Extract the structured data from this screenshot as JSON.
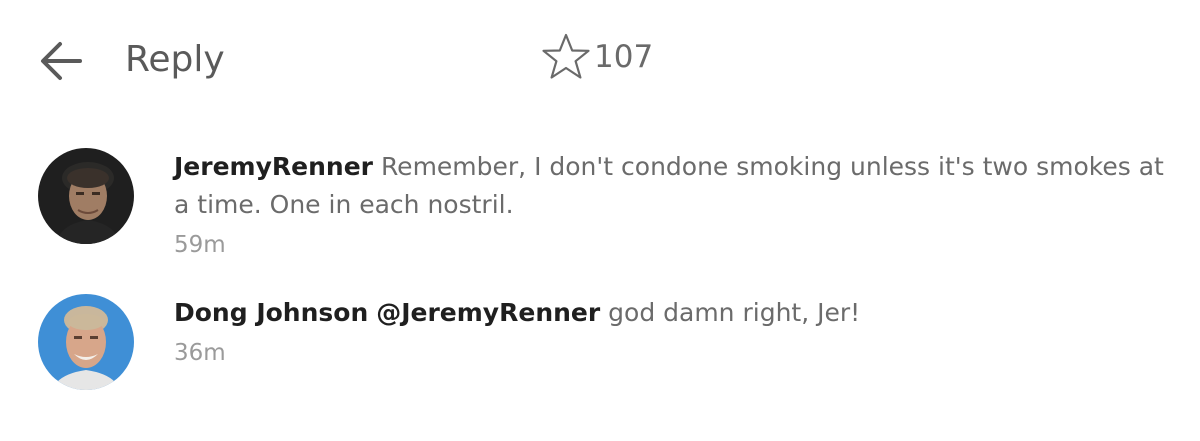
{
  "header": {
    "title": "Reply",
    "back_icon": "arrow-left-icon",
    "star_icon": "star-outline-icon",
    "star_count": "107"
  },
  "comments": [
    {
      "author": "JeremyRenner",
      "text": "Remember, I don't condone smoking unless it's two smokes at a time. One in each nostril.",
      "time": "59m",
      "avatar_bg": "#1f1f1f"
    },
    {
      "author": "Dong Johnson",
      "mention": "@JeremyRenner",
      "text": "god damn right, Jer!",
      "time": "36m",
      "avatar_bg": "#3f8fd6"
    }
  ],
  "colors": {
    "text_primary": "#1f1f1f",
    "text_secondary": "#6b6b6b",
    "timestamp": "#9a9a9a",
    "icon": "#5a5a5a"
  }
}
